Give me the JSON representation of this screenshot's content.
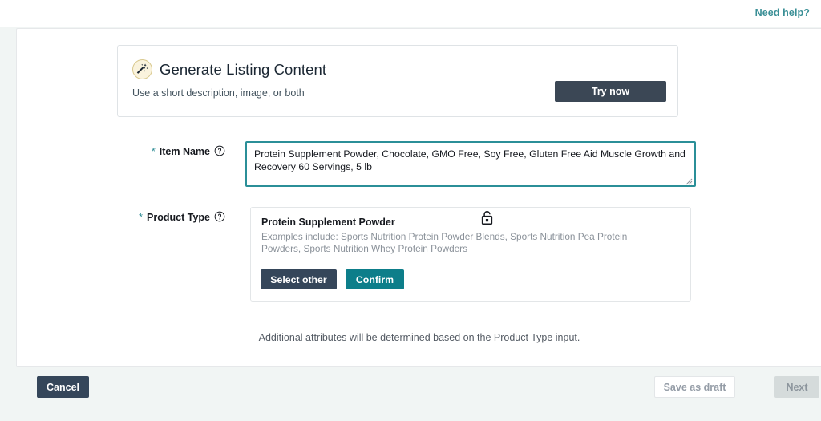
{
  "topbar": {
    "need_help_label": "Need help?",
    "link_color": "#3a8f96"
  },
  "generate_card": {
    "icon": "magic-wand-icon",
    "title": "Generate Listing Content",
    "subtitle": "Use a short description, image, or both",
    "try_now_label": "Try now",
    "try_now_color": "#3b4755"
  },
  "item_name": {
    "label": "Item Name",
    "required_marker": "*",
    "help_icon": "help-circle-icon",
    "value": "Protein Supplement Powder, Chocolate, GMO Free, Soy Free, Gluten Free Aid Muscle Growth and Recovery 60 Servings, 5 lb",
    "placeholder": "",
    "focus_border_color": "#2b8f98"
  },
  "product_type": {
    "label": "Product Type",
    "required_marker": "*",
    "help_icon": "help-circle-icon",
    "suggestion_title": "Protein Supplement Powder",
    "suggestion_examples": "Examples include: Sports Nutrition Protein Powder Blends, Sports Nutrition Pea Protein Powders, Sports Nutrition Whey Protein Powders",
    "select_other_label": "Select other",
    "confirm_label": "Confirm",
    "confirm_color": "#0d7e8a",
    "select_other_color": "#35465a",
    "lock_icon": "lock-icon"
  },
  "note": {
    "text": "Additional attributes will be determined based on the Product Type input."
  },
  "footer": {
    "cancel_label": "Cancel",
    "save_draft_label": "Save as draft",
    "next_label": "Next"
  }
}
